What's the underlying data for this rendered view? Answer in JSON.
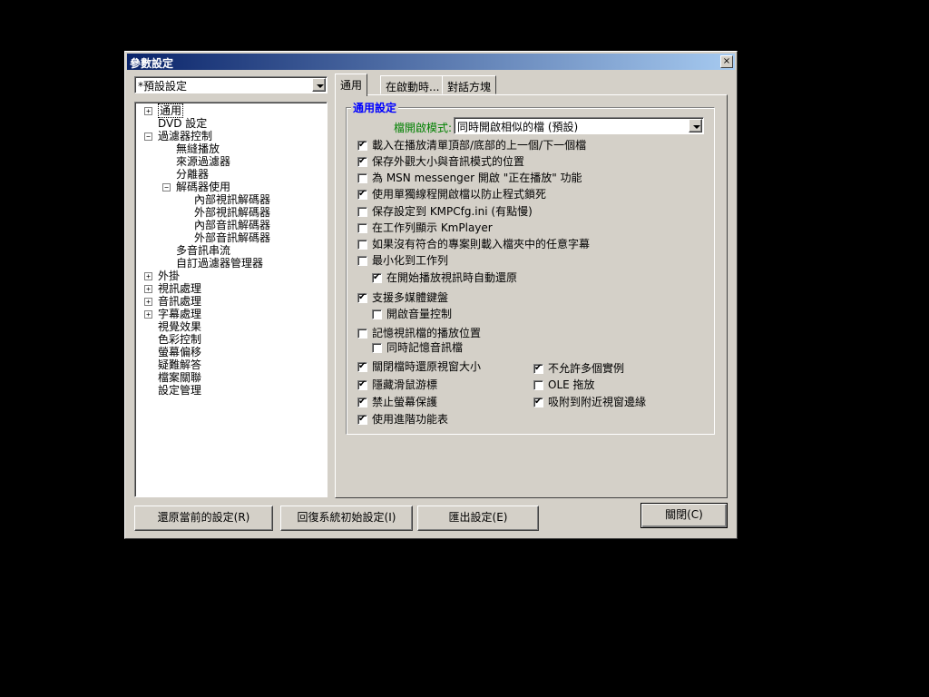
{
  "window": {
    "title": "參數設定",
    "close": "×"
  },
  "preset": {
    "value": "*預設設定"
  },
  "tree": {
    "items": [
      {
        "label": "通用",
        "expander": "+"
      },
      {
        "label": "DVD 設定"
      },
      {
        "label": "過濾器控制",
        "expander": "−"
      },
      {
        "label": "無縫播放"
      },
      {
        "label": "來源過濾器"
      },
      {
        "label": "分離器"
      },
      {
        "label": "解碼器使用",
        "expander": "−"
      },
      {
        "label": "內部視訊解碼器"
      },
      {
        "label": "外部視訊解碼器"
      },
      {
        "label": "內部音訊解碼器"
      },
      {
        "label": "外部音訊解碼器"
      },
      {
        "label": "多音訊串流"
      },
      {
        "label": "自訂過濾器管理器"
      },
      {
        "label": "外掛",
        "expander": "+"
      },
      {
        "label": "視訊處理",
        "expander": "+"
      },
      {
        "label": "音訊處理",
        "expander": "+"
      },
      {
        "label": "字幕處理",
        "expander": "+"
      },
      {
        "label": "視覺效果"
      },
      {
        "label": "色彩控制"
      },
      {
        "label": "螢幕偏移"
      },
      {
        "label": "疑難解答"
      },
      {
        "label": "檔案關聯"
      },
      {
        "label": "設定管理"
      }
    ]
  },
  "tabs": [
    {
      "label": "通用"
    },
    {
      "label": "在啟動時..."
    },
    {
      "label": "對話方塊"
    }
  ],
  "general": {
    "group_title": "通用設定",
    "open_mode_label": "檔開啟模式:",
    "open_mode_value": "同時開啟相似的檔 (預設)",
    "options": [
      {
        "label": "載入在播放清單頂部/底部的上一個/下一個檔",
        "checked": true
      },
      {
        "label": "保存外觀大小與音訊模式的位置",
        "checked": true
      },
      {
        "label": "為 MSN messenger 開啟 \"正在播放\" 功能",
        "checked": false
      },
      {
        "label": "使用單獨線程開啟檔以防止程式鎖死",
        "checked": true
      },
      {
        "label": "保存設定到 KMPCfg.ini (有點慢)",
        "checked": false
      },
      {
        "label": "在工作列顯示 KmPlayer",
        "checked": false
      },
      {
        "label": "如果沒有符合的專案則載入檔夾中的任意字幕",
        "checked": false
      },
      {
        "label": "最小化到工作列",
        "checked": false
      },
      {
        "label": "在開始播放視訊時自動還原",
        "checked": true
      },
      {
        "label": "支援多媒體鍵盤",
        "checked": true
      },
      {
        "label": "開啟音量控制",
        "checked": false
      },
      {
        "label": "記憶視訊檔的播放位置",
        "checked": false
      },
      {
        "label": "同時記憶音訊檔",
        "checked": false
      },
      {
        "label": "關閉檔時還原視窗大小",
        "checked": true
      },
      {
        "label": "隱藏滑鼠游標",
        "checked": true
      },
      {
        "label": "禁止螢幕保護",
        "checked": true
      },
      {
        "label": "使用進階功能表",
        "checked": true
      },
      {
        "label": "不允許多個實例",
        "checked": true
      },
      {
        "label": "OLE 拖放",
        "checked": false
      },
      {
        "label": "吸附到附近視窗邊緣",
        "checked": true
      }
    ]
  },
  "buttons": {
    "restore": "還原當前的設定(R)",
    "reset": "回復系統初始設定(I)",
    "export": "匯出設定(E)",
    "close": "關閉(C)"
  },
  "colors": {
    "title_start": "#0a246a",
    "title_end": "#a6caf0",
    "group_title": "#0000ff",
    "open_mode_label": "#008000"
  }
}
